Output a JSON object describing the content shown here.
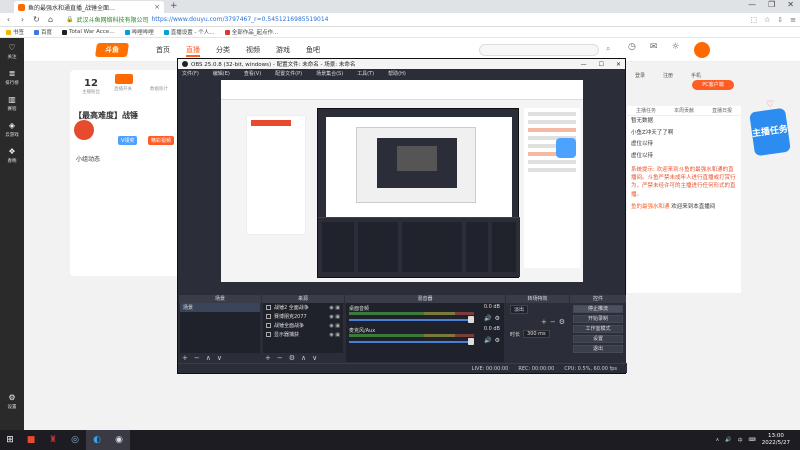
{
  "browser": {
    "tab_title": "鱼的最强水和通直播_战锤全面…",
    "tab_close": "×",
    "new_tab": "+",
    "win_controls": [
      "—",
      "❐",
      "✕"
    ],
    "url_secure": "🔒",
    "url_site": "武汉斗鱼网络科技有限公司",
    "url_full": "https://www.douyu.com/3797467_r=0.5451216985519014",
    "bookmarks": [
      "书签",
      "百度",
      "Total War Acce…",
      "哔哩哔哩",
      "直播设置 - 个人…",
      "全部作品_起点作…"
    ]
  },
  "douyu": {
    "logo": "斗鱼",
    "nav": [
      "首页",
      "直播",
      "分类",
      "视频",
      "游戏",
      "鱼吧"
    ],
    "nav_active": "直播",
    "sidebar": [
      {
        "label": "关注",
        "icon": "♡"
      },
      {
        "label": "排行榜",
        "icon": "≣"
      },
      {
        "label": "赛程",
        "icon": "▥"
      },
      {
        "label": "云游戏",
        "icon": "◈"
      },
      {
        "label": "春晚",
        "icon": "❖"
      }
    ],
    "sidebar_bottom": {
      "label": "设置",
      "icon": "⚙"
    },
    "room": {
      "follow_number": "12",
      "follow_label": "主播粉丝",
      "badge_labels": [
        "直播开关",
        "数据统计"
      ],
      "title": "【最高难度】战锤",
      "tag1": "V领奖",
      "tag2": "精彩视频",
      "feed_title": "小组动态"
    },
    "right": {
      "header": [
        "登录",
        "注册",
        "手机"
      ],
      "pc_button": "PC客户端",
      "tabs": [
        "主播任务",
        "本周贡献",
        "直播日报"
      ],
      "lines": [
        "暂无数据",
        "小鱼Z冲天了了啊",
        "虚位以待",
        "虚位以待"
      ],
      "notice": "系统提示: 欢迎来到斗鱼的最强水和通的直播间。斗鱼严禁未成年人进行直播或打赏行为，严禁未经许可的主播进行任何形式的直播。",
      "footer_user": "鱼的最强水和通",
      "footer_text": "欢迎来到本直播间"
    },
    "promo": "主播任务"
  },
  "obs": {
    "title": "OBS 25.0.8 (32-bit, windows) - 配置文件: 未命名 - 场景: 未命名",
    "menu": [
      "文件(F)",
      "编辑(E)",
      "查看(V)",
      "配置文件(P)",
      "场景集合(S)",
      "工具(T)",
      "帮助(H)"
    ],
    "docks": {
      "scenes_title": "场景",
      "scenes": [
        "场景"
      ],
      "sources_title": "来源",
      "sources": [
        "战锤2 全面战争",
        "赛博朋克2077",
        "战锤全面战争",
        "显示器捕获"
      ],
      "mixer_title": "混音器",
      "mixer": [
        {
          "name": "桌面音频",
          "db": "0.0 dB"
        },
        {
          "name": "麦克风/Aux",
          "db": "0.0 dB"
        }
      ],
      "transitions_title": "转场特效",
      "transition_type": "淡出",
      "duration_label": "时长",
      "duration_value": "300 ms",
      "controls_title": "控件",
      "controls": [
        "停止推流",
        "开始录制",
        "工作室模式",
        "设置",
        "退出"
      ]
    },
    "status": [
      "LIVE: 00:00:00",
      "REC: 00:00:00",
      "CPU: 0.5%, 60.00 fps"
    ]
  },
  "taskbar": {
    "time": "13:00",
    "date": "2022/5/27",
    "tray": [
      "∧",
      "🔊",
      "中",
      "⌨"
    ]
  }
}
